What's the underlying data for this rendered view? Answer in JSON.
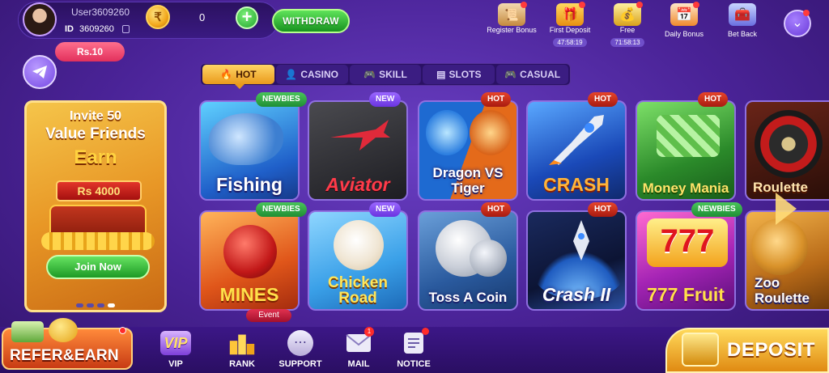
{
  "header": {
    "username": "User3609260",
    "id_label": "ID",
    "user_id": "3609260",
    "balance": "0",
    "withdraw_label": "WITHDRAW",
    "icons": [
      {
        "label": "Register Bonus",
        "timer": "",
        "icon": "scroll-icon"
      },
      {
        "label": "First Deposit",
        "timer": "47:58:19",
        "icon": "gift-icon"
      },
      {
        "label": "Free",
        "timer": "71:58:13",
        "icon": "coins-icon"
      },
      {
        "label": "Daily Bonus",
        "timer": "",
        "icon": "calendar-icon"
      },
      {
        "label": "Bet Back",
        "timer": "",
        "icon": "chest-icon"
      }
    ]
  },
  "left": {
    "reward_badge": "Rs.10",
    "invite": {
      "line1": "Invite 50",
      "line2": "Value Friends",
      "line3": "Earn",
      "amount": "Rs 4000",
      "join_label": "Join Now"
    }
  },
  "tabs": [
    {
      "label": "HOT",
      "icon": "flame-icon",
      "active": true
    },
    {
      "label": "CASINO",
      "icon": "person-icon",
      "active": false
    },
    {
      "label": "SKILL",
      "icon": "gamepad-icon",
      "active": false
    },
    {
      "label": "SLOTS",
      "icon": "slots-icon",
      "active": false
    },
    {
      "label": "CASUAL",
      "icon": "gamepad-icon",
      "active": false
    }
  ],
  "games": [
    {
      "title": "Fishing",
      "tag": "NEWBIES"
    },
    {
      "title": "Aviator",
      "tag": "NEW"
    },
    {
      "title": "Dragon VS Tiger",
      "tag": "HOT"
    },
    {
      "title": "CRASH",
      "tag": "HOT"
    },
    {
      "title": "Money Mania",
      "tag": "HOT"
    },
    {
      "title": "Roulette",
      "tag": ""
    },
    {
      "title": "MINES",
      "tag": "NEWBIES"
    },
    {
      "title": "Chicken Road",
      "tag": "NEW"
    },
    {
      "title": "Toss A Coin",
      "tag": "HOT"
    },
    {
      "title": "Crash II",
      "tag": "HOT"
    },
    {
      "title": "777 Fruit",
      "tag": "NEWBIES"
    },
    {
      "title": "Zoo Roulette",
      "tag": ""
    }
  ],
  "bottom": {
    "refer_label": "REFER&EARN",
    "event_label": "Event",
    "deposit_label": "DEPOSIT",
    "nav": [
      {
        "label": "VIP",
        "badge": ""
      },
      {
        "label": "RANK",
        "badge": ""
      },
      {
        "label": "SUPPORT",
        "badge": ""
      },
      {
        "label": "MAIL",
        "badge": "1"
      },
      {
        "label": "NOTICE",
        "badge": ""
      }
    ]
  },
  "colors": {
    "background": "#4a2397",
    "accent_gold": "#e99a1c",
    "green": "#1d9a25",
    "hot_red": "#a81a10"
  }
}
